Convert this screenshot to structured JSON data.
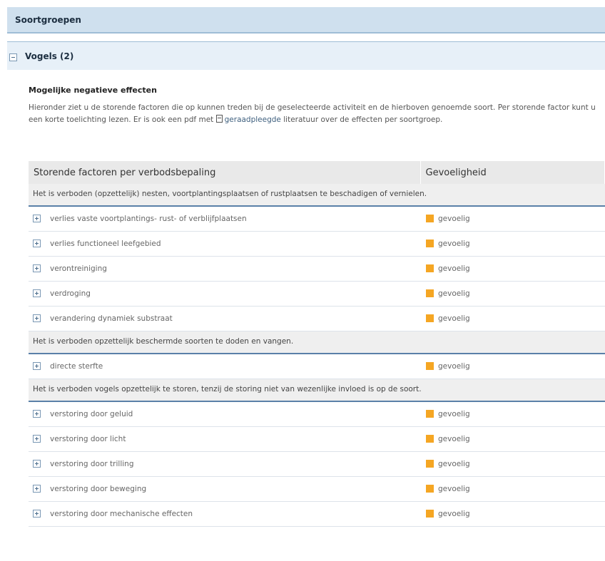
{
  "section_title": "Soortgroepen",
  "group": {
    "title": "Vogels (2)"
  },
  "intro": {
    "title": "Mogelijke negatieve effecten",
    "text_before": "Hieronder ziet u de storende factoren die op kunnen treden bij de geselecteerde activiteit en de hierboven genoemde soort. Per storende factor kunt u een korte toelichting lezen. Er is ook een pdf met",
    "link": "geraadpleegde",
    "text_after": "literatuur over de effecten per soortgroep."
  },
  "table": {
    "headers": [
      "Storende factoren per verbodsbepaling",
      "Gevoeligheid"
    ],
    "sensitivity_color": "#f5a623",
    "sections": [
      {
        "heading": "Het is verboden (opzettelijk) nesten, voortplantingsplaatsen of rustplaatsen te beschadigen of vernielen.",
        "items": [
          {
            "factor": "verlies vaste voortplantings- rust- of verblijfplaatsen",
            "sensitivity": "gevoelig"
          },
          {
            "factor": "verlies functioneel leefgebied",
            "sensitivity": "gevoelig"
          },
          {
            "factor": "verontreiniging",
            "sensitivity": "gevoelig"
          },
          {
            "factor": "verdroging",
            "sensitivity": "gevoelig"
          },
          {
            "factor": "verandering dynamiek substraat",
            "sensitivity": "gevoelig"
          }
        ]
      },
      {
        "heading": "Het is verboden opzettelijk beschermde soorten te doden en vangen.",
        "items": [
          {
            "factor": "directe sterfte",
            "sensitivity": "gevoelig"
          }
        ]
      },
      {
        "heading": "Het is verboden vogels opzettelijk te storen, tenzij de storing niet van wezenlijke invloed is op de soort.",
        "items": [
          {
            "factor": "verstoring door geluid",
            "sensitivity": "gevoelig"
          },
          {
            "factor": "verstoring door licht",
            "sensitivity": "gevoelig"
          },
          {
            "factor": "verstoring door trilling",
            "sensitivity": "gevoelig"
          },
          {
            "factor": "verstoring door beweging",
            "sensitivity": "gevoelig"
          },
          {
            "factor": "verstoring door mechanische effecten",
            "sensitivity": "gevoelig"
          }
        ]
      }
    ]
  }
}
